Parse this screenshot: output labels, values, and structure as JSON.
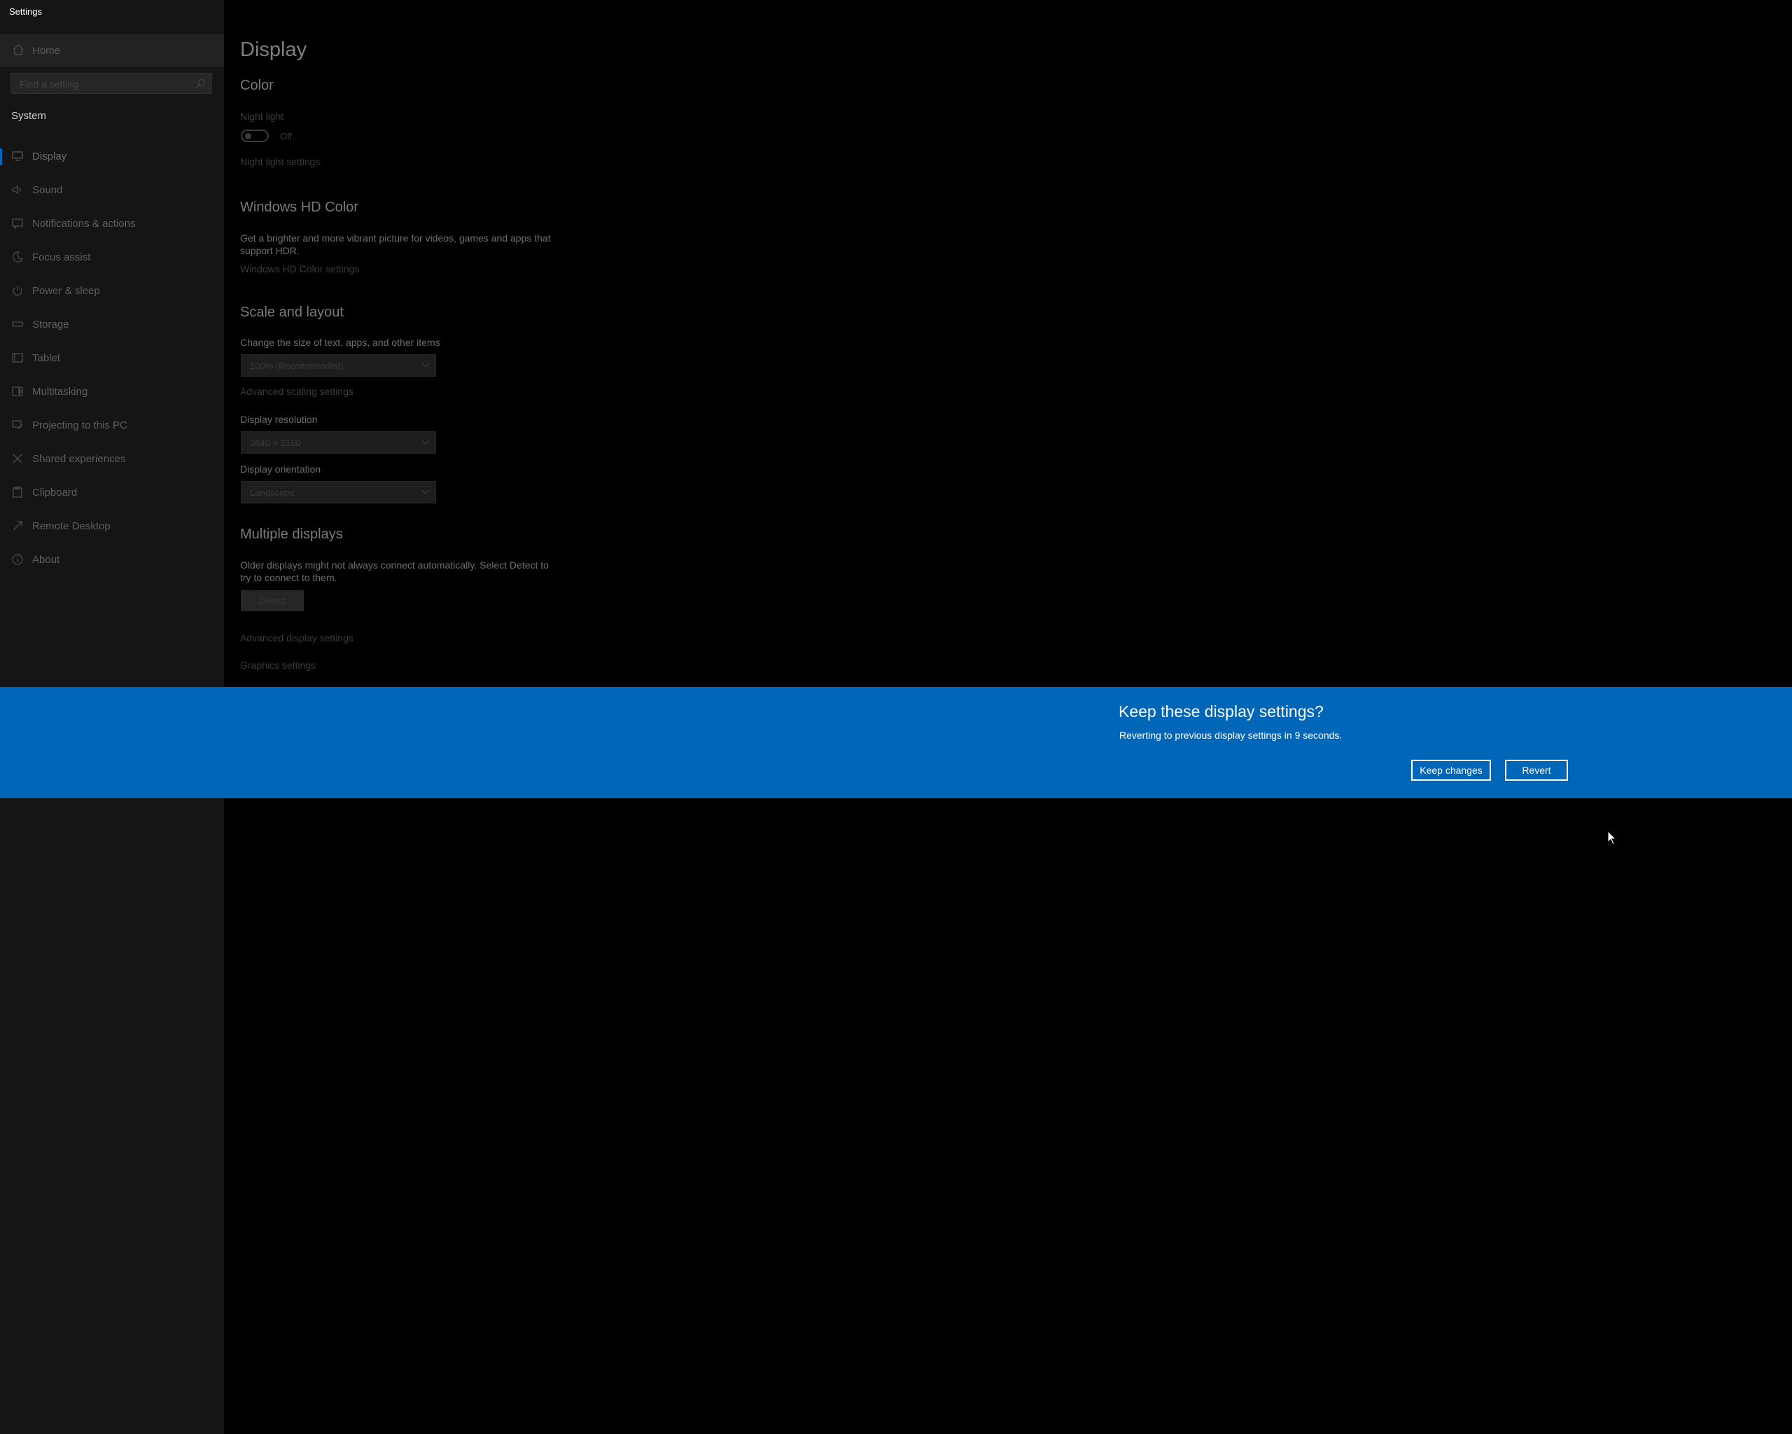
{
  "app": {
    "title": "Settings"
  },
  "sidebar": {
    "home_label": "Home",
    "search_placeholder": "Find a setting",
    "section_label": "System",
    "items": [
      {
        "label": "Display",
        "icon": "monitor-icon",
        "active": true
      },
      {
        "label": "Sound",
        "icon": "speaker-icon"
      },
      {
        "label": "Notifications & actions",
        "icon": "notification-icon"
      },
      {
        "label": "Focus assist",
        "icon": "moon-icon"
      },
      {
        "label": "Power & sleep",
        "icon": "power-icon"
      },
      {
        "label": "Storage",
        "icon": "storage-icon"
      },
      {
        "label": "Tablet",
        "icon": "tablet-icon"
      },
      {
        "label": "Multitasking",
        "icon": "multitasking-icon"
      },
      {
        "label": "Projecting to this PC",
        "icon": "projector-icon"
      },
      {
        "label": "Shared experiences",
        "icon": "shared-icon"
      },
      {
        "label": "Clipboard",
        "icon": "clipboard-icon"
      },
      {
        "label": "Remote Desktop",
        "icon": "remote-desktop-icon"
      },
      {
        "label": "About",
        "icon": "info-icon"
      }
    ]
  },
  "main": {
    "title": "Display",
    "color": {
      "heading": "Color",
      "night_light_label": "Night light",
      "night_light_state": "Off",
      "night_light_settings_link": "Night light settings"
    },
    "hdr": {
      "heading": "Windows HD Color",
      "description": "Get a brighter and more vibrant picture for videos, games and apps that support HDR.",
      "settings_link": "Windows HD Color settings"
    },
    "scale": {
      "heading": "Scale and layout",
      "size_label": "Change the size of text, apps, and other items",
      "size_value": "100% (Recommended)",
      "advanced_link": "Advanced scaling settings",
      "resolution_label": "Display resolution",
      "resolution_value": "3840 × 2160",
      "orientation_label": "Display orientation",
      "orientation_value": "Landscape"
    },
    "multiple": {
      "heading": "Multiple displays",
      "description": "Older displays might not always connect automatically. Select Detect to try to connect to them.",
      "detect_label": "Detect",
      "advanced_display_link": "Advanced display settings",
      "graphics_link": "Graphics settings"
    }
  },
  "banner": {
    "title": "Keep these display settings?",
    "subtitle": "Reverting to previous display settings in  9 seconds.",
    "keep_label": "Keep changes",
    "revert_label": "Revert",
    "color": "#0067b8"
  }
}
